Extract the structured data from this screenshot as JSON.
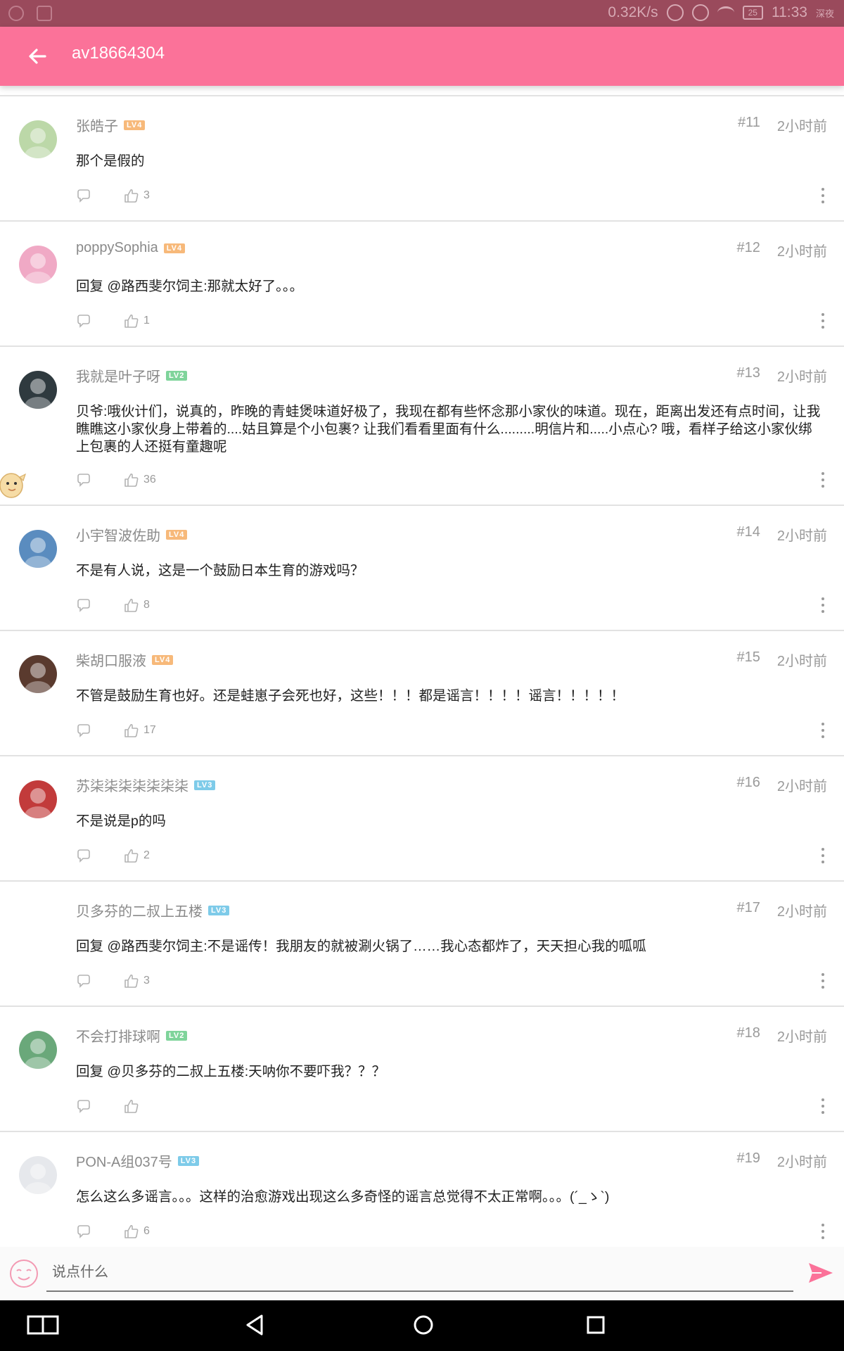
{
  "status_bar": {
    "speed": "0.32K/s",
    "battery": "25",
    "time": "11:33",
    "extra": "深夜"
  },
  "header": {
    "title": "av18664304"
  },
  "colors": {
    "brand_pink": "#fb7299",
    "lv2": "#7fd49b",
    "lv3": "#7ecbe9",
    "lv4": "#f7b97a"
  },
  "comments": [
    {
      "user": "张皓子",
      "level": "LV4",
      "floor": "#11",
      "time": "2小时前",
      "text": "那个是假的",
      "likes": "3",
      "avatar_color": "#bcd8a8"
    },
    {
      "user": "poppySophia",
      "level": "LV4",
      "floor": "#12",
      "time": "2小时前",
      "text": "回复 @路西斐尔饲主:那就太好了。。。",
      "likes": "1",
      "avatar_color": "#f0a9c5"
    },
    {
      "user": "我就是叶子呀",
      "level": "LV2",
      "floor": "#13",
      "time": "2小时前",
      "text": "贝爷:哦伙计们，说真的，昨晚的青蛙煲味道好极了，我现在都有些怀念那小家伙的味道。现在，距离出发还有点时间，让我瞧瞧这小家伙身上带着的....姑且算是个小包裹? 让我们看看里面有什么.........明信片和.....小点心? 哦，看样子给这小家伙绑上包裹的人还挺有童趣呢",
      "likes": "36",
      "avatar_color": "#2f3a3f"
    },
    {
      "user": "小宇智波佐助",
      "level": "LV4",
      "floor": "#14",
      "time": "2小时前",
      "text": "不是有人说，这是一个鼓励日本生育的游戏吗？",
      "likes": "8",
      "avatar_color": "#5a8cbf"
    },
    {
      "user": "柴胡口服液",
      "level": "LV4",
      "floor": "#15",
      "time": "2小时前",
      "text": "不管是鼓励生育也好。还是蛙崽子会死也好，这些！！！都是谣言！！！！谣言！！！！！",
      "likes": "17",
      "avatar_color": "#5a3a2e"
    },
    {
      "user": "苏柒柒柒柒柒柒柒",
      "level": "LV3",
      "floor": "#16",
      "time": "2小时前",
      "text": "不是说是p的吗",
      "likes": "2",
      "avatar_color": "#c23b3b"
    },
    {
      "user": "贝多芬的二叔上五楼",
      "level": "LV3",
      "floor": "#17",
      "time": "2小时前",
      "text": "回复 @路西斐尔饲主:不是谣传！我朋友的就被涮火锅了……我心态都炸了，天天担心我的呱呱",
      "likes": "3",
      "avatar_color": "#ffffff"
    },
    {
      "user": "不会打排球啊",
      "level": "LV2",
      "floor": "#18",
      "time": "2小时前",
      "text": "回复 @贝多芬的二叔上五楼:天呐你不要吓我？？？",
      "likes": "",
      "avatar_color": "#6aa87a"
    },
    {
      "user": "PON-A组037号",
      "level": "LV3",
      "floor": "#19",
      "time": "2小时前",
      "text": "怎么这么多谣言。。。这样的治愈游戏出现这么多奇怪的谣言总觉得不太正常啊。。。(´_ゝ`)",
      "likes": "6",
      "avatar_color": "#e6e8ec"
    }
  ],
  "input": {
    "placeholder": "说点什么",
    "value": ""
  },
  "icons": {
    "back": "arrow-left-icon",
    "send": "send-icon",
    "emoji": "emoji-icon",
    "reply": "comment-bubble-icon",
    "like": "thumbs-up-icon",
    "more": "more-vertical-icon"
  }
}
